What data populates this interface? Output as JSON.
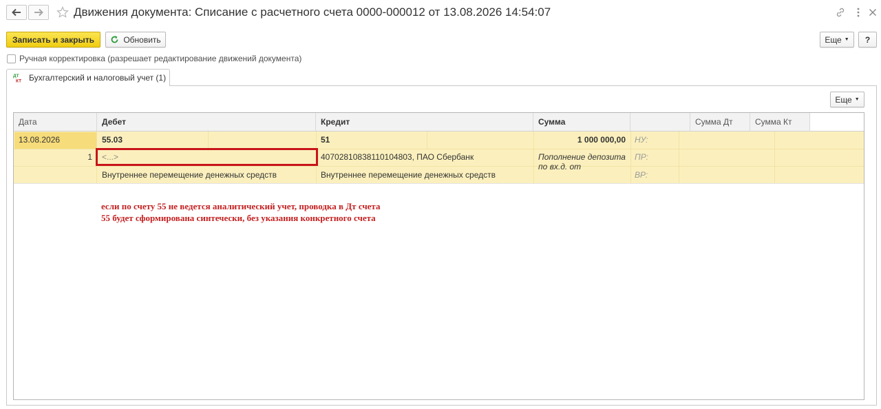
{
  "window": {
    "title": "Движения документа: Списание с расчетного счета 0000-000012 от 13.08.2026 14:54:07"
  },
  "toolbar": {
    "save_close_label": "Записать и закрыть",
    "refresh_label": "Обновить",
    "more_label": "Еще",
    "help_label": "?"
  },
  "manual_edit": {
    "label": "Ручная корректировка (разрешает редактирование движений документа)",
    "checked": false
  },
  "main": {
    "tab": {
      "label": "Бухгалтерский и налоговый учет (1)"
    },
    "grid_more_label": "Еще",
    "columns": [
      "Дата",
      "Дебет",
      "Кредит",
      "Сумма",
      "",
      "Сумма Дт",
      "Сумма Кт"
    ],
    "entry": {
      "date": "13.08.2026",
      "row_no": "1",
      "debit": {
        "account": "55.03",
        "subconto": "<...>",
        "purpose": "Внутреннее перемещение денежных средств"
      },
      "credit": {
        "account": "51",
        "subconto": "40702810838110104803, ПАО Сбербанк",
        "purpose": "Внутреннее перемещение денежных средств"
      },
      "amount": "1 000 000,00",
      "content_line1": "Пополнение депозита",
      "content_line2": "по вх.д.  от",
      "tax_labels": [
        "НУ:",
        "ПР:",
        "ВР:"
      ]
    }
  },
  "annotation": {
    "text": "если по счету 55 не ведется аналитический учет, проводка в Дт счета 55 будет сформирована синтечески, без указания конкретного счета"
  },
  "colors": {
    "accent_yellow": "#f4d31f",
    "row_highlight": "#fbf0bd",
    "annotation_red": "#c31f1f"
  }
}
